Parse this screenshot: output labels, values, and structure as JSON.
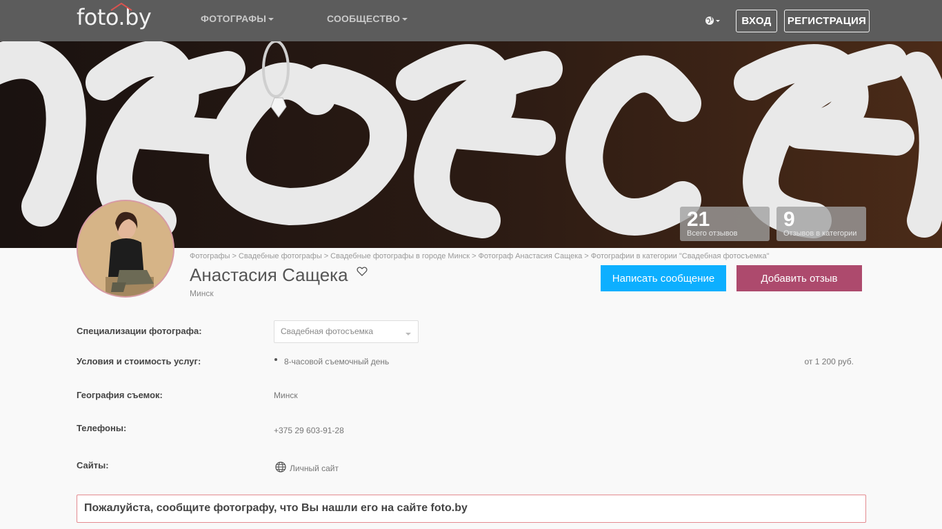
{
  "header": {
    "logo": "foto.by",
    "nav": [
      {
        "label": "ФОТОГРАФЫ"
      },
      {
        "label": "СООБЩЕСТВО"
      }
    ],
    "login_label": "ВХОД",
    "register_label": "РЕГИСТРАЦИЯ"
  },
  "stats": [
    {
      "value": "21",
      "label": "Всего отзывов"
    },
    {
      "value": "9",
      "label": "Отзывов в категории"
    }
  ],
  "breadcrumb": [
    "Фотографы",
    "Свадебные фотографы",
    "Свадебные фотографы в городе Минск",
    "Фотограф Анастасия Сащека",
    "Фотографии в категории \"Свадебная фотосъемка\""
  ],
  "breadcrumb_sep": ">",
  "profile": {
    "name": "Анастасия Сащека",
    "city": "Минск",
    "message_button": "Написать сообщение",
    "review_button": "Добавить отзыв"
  },
  "details": {
    "specializations_label": "Специализации фотографа:",
    "specializations_value": "Свадебная фотосъемка",
    "terms_label": "Условия и стоимость услуг:",
    "terms_item": "8-часовой съемочный день",
    "terms_price": "от 1 200 руб.",
    "geo_label": "География съемок:",
    "geo_value": "Минск",
    "phones_label": "Телефоны:",
    "phones_value": "+375 29 603-91-28",
    "sites_label": "Сайты:",
    "sites_value": "Личный сайт"
  },
  "notice": "Пожалуйста, сообщите фотографу, что Вы нашли его на сайте foto.by",
  "colors": {
    "navbar": "#5c5c5c",
    "message_button": "#0dafff",
    "review_button": "#ad4a6d",
    "notice_border": "#e38a8f"
  }
}
